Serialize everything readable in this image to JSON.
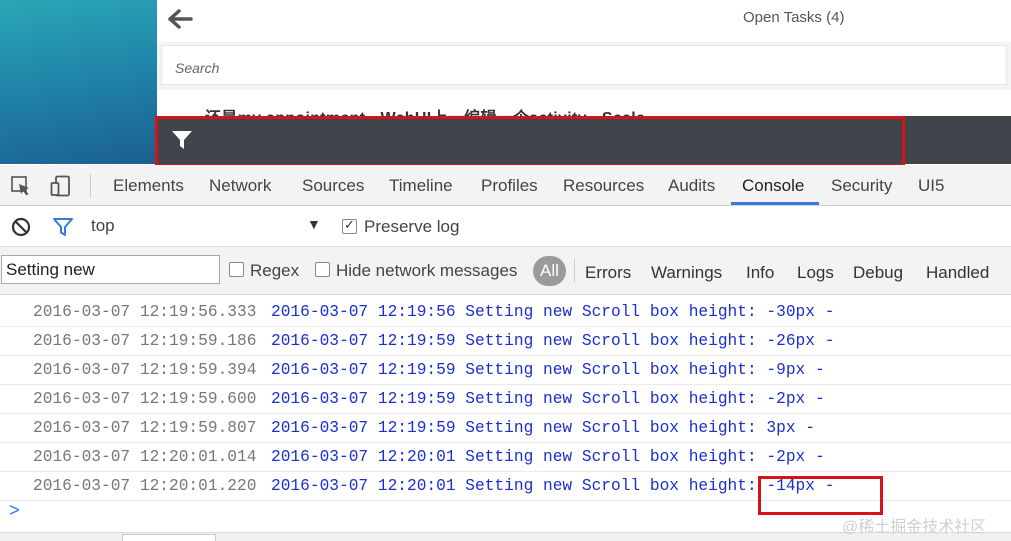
{
  "app": {
    "title": "Open Tasks (4)",
    "search_placeholder": "Search",
    "peek_text": "还是my appointment - WebUI上一编辑一个activity - Scale",
    "brand_gradient": [
      "#2aa7b6",
      "#1b5f8f"
    ],
    "filter_bar_color": "#3f454a"
  },
  "devtools": {
    "tabs": [
      "Elements",
      "Network",
      "Sources",
      "Timeline",
      "Profiles",
      "Resources",
      "Audits",
      "Console",
      "Security",
      "UI5"
    ],
    "active_tab": "Console",
    "context": "top",
    "preserve_log_label": "Preserve log",
    "preserve_log_checked": true,
    "filter_value": "Setting new",
    "regex_label": "Regex",
    "hide_network_label": "Hide network messages",
    "levels": {
      "all": "All",
      "errors": "Errors",
      "warnings": "Warnings",
      "info": "Info",
      "logs": "Logs",
      "debug": "Debug",
      "handled": "Handled"
    },
    "accent": "#3879d9"
  },
  "log": [
    {
      "ts": "2016-03-07 12:19:56.333",
      "msg": "2016-03-07 12:19:56 Setting new Scroll box height: -30px -"
    },
    {
      "ts": "2016-03-07 12:19:59.186",
      "msg": "2016-03-07 12:19:59 Setting new Scroll box height: -26px -"
    },
    {
      "ts": "2016-03-07 12:19:59.394",
      "msg": "2016-03-07 12:19:59 Setting new Scroll box height: -9px -"
    },
    {
      "ts": "2016-03-07 12:19:59.600",
      "msg": "2016-03-07 12:19:59 Setting new Scroll box height: -2px -"
    },
    {
      "ts": "2016-03-07 12:19:59.807",
      "msg": "2016-03-07 12:19:59 Setting new Scroll box height: 3px -"
    },
    {
      "ts": "2016-03-07 12:20:01.014",
      "msg": "2016-03-07 12:20:01 Setting new Scroll box height: -2px -"
    },
    {
      "ts": "2016-03-07 12:20:01.220",
      "msg": "2016-03-07 12:20:01 Setting new Scroll box height: -14px -"
    }
  ],
  "prompt_symbol": ">",
  "watermark": "@稀土掘金技术社区",
  "highlight_color": "#d9121a"
}
